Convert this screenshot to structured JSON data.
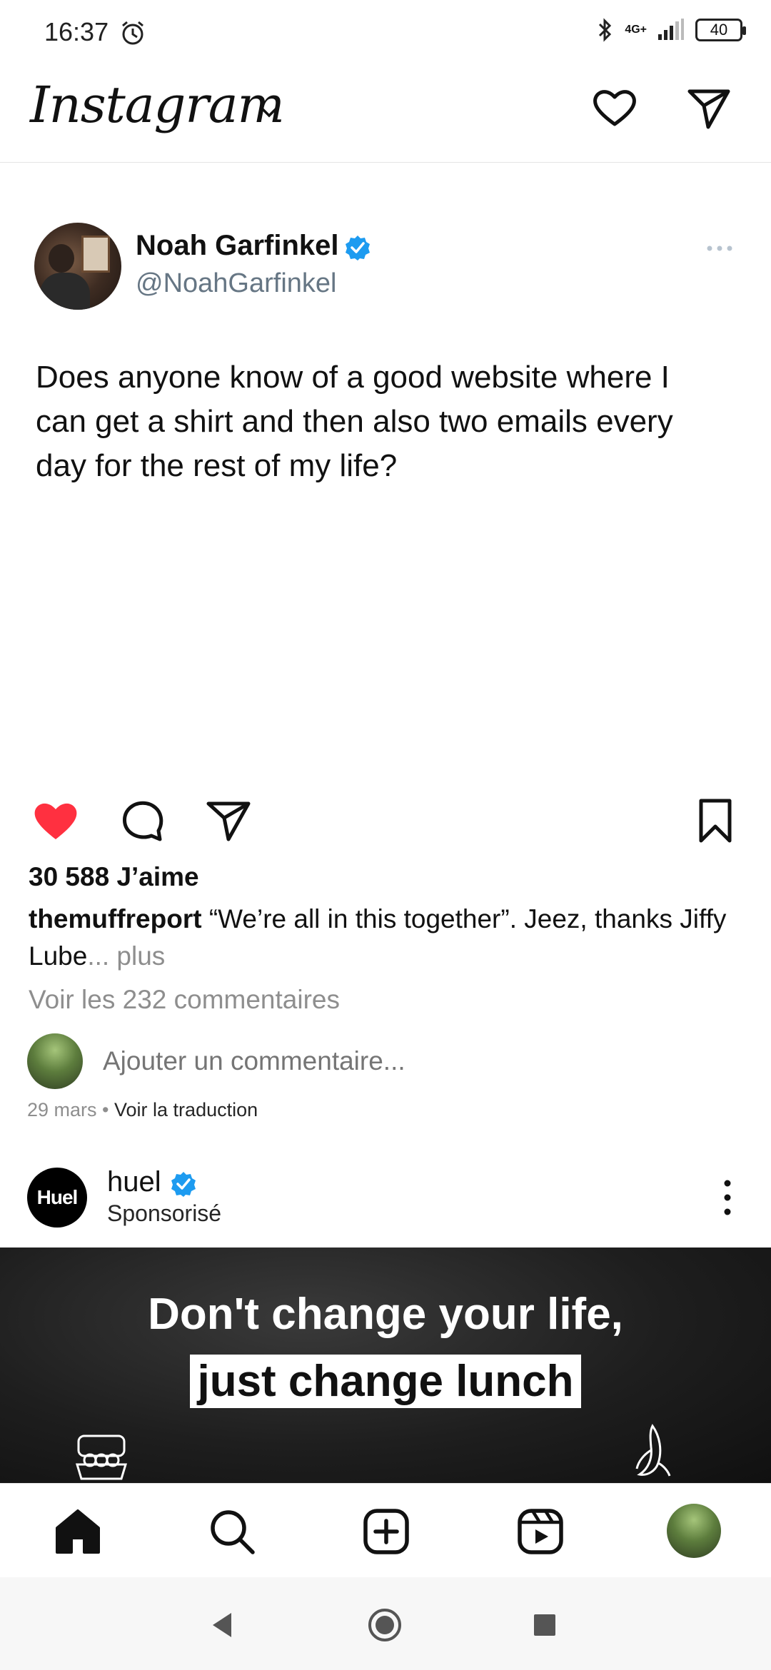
{
  "status_bar": {
    "time": "16:37",
    "network": "4G+",
    "battery": "40",
    "icons": [
      "alarm-icon",
      "bluetooth-icon",
      "signal-icon",
      "battery-icon"
    ]
  },
  "header": {
    "logo": "Instagram",
    "icons": [
      "chevron-down-icon",
      "heart-icon",
      "send-icon"
    ]
  },
  "post": {
    "tweet": {
      "name": "Noah Garfinkel",
      "handle": "@NoahGarfinkel",
      "text": "Does anyone know of a good website where I can get a shirt and then also two emails every day for the rest of my life?"
    },
    "likes": "30 588 J’aime",
    "caption_user": "themuffreport",
    "caption_text": " “We’re all in this together”. Jeez, thanks Jiffy Lube",
    "caption_ellipsis": "...",
    "caption_more": " plus",
    "view_comments": "Voir les 232 commentaires",
    "comment_placeholder": "Ajouter un commentaire...",
    "date": "29 mars",
    "separator": " • ",
    "translate": "Voir la traduction"
  },
  "sponsored": {
    "avatar_text": "Huel",
    "name": "huel",
    "label": "Sponsorisé",
    "ad_line1": "Don't change your life,",
    "ad_line2": "just change lunch"
  },
  "colors": {
    "like_red": "#ff3040",
    "verified_blue": "#1d9bf0",
    "muted_text": "#8e8e8e"
  }
}
